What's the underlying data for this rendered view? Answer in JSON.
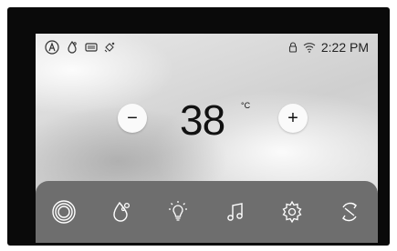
{
  "status_bar": {
    "left_icons": [
      "auto-mode-icon",
      "rain-shower-icon",
      "heater-icon",
      "steam-icon"
    ],
    "right_icons": [
      "lock-icon",
      "wifi-icon"
    ],
    "time": "2:22 PM"
  },
  "temperature": {
    "value": "38",
    "unit": "°C",
    "decrease_label": "−",
    "increase_label": "+"
  },
  "dock": {
    "items": [
      "whirlpool-icon",
      "shower-icon",
      "light-bulb-icon",
      "music-note-icon",
      "settings-gear-icon",
      "power-cycle-icon"
    ]
  },
  "colors": {
    "bezel": "#0a0a0a",
    "dock": "#6e6e6e",
    "icon_light": "#ffffff",
    "text": "#111111"
  }
}
